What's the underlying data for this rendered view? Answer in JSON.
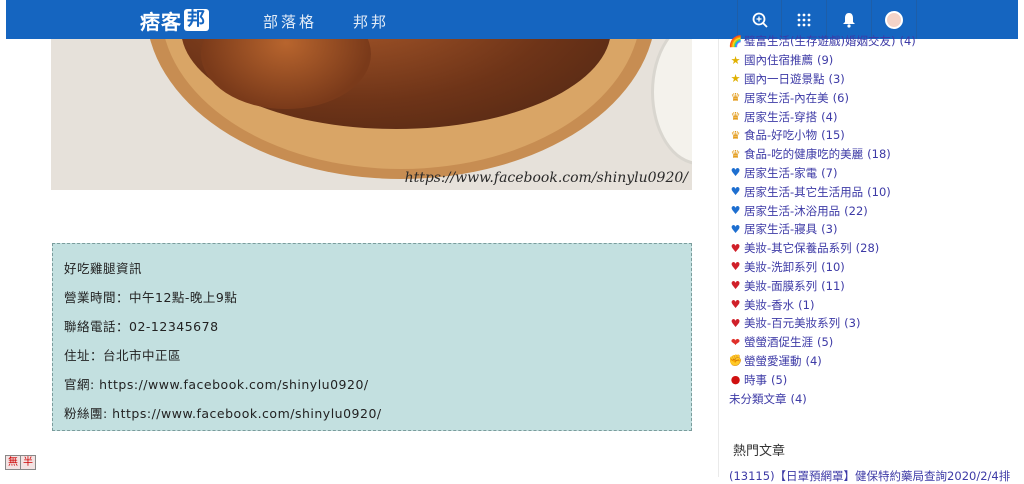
{
  "header": {
    "logo_text": "痞客",
    "logo_box": "邦",
    "nav_blog": "部落格",
    "nav_bang": "邦邦",
    "icons": [
      "search-icon",
      "apps-grid-icon",
      "bell-icon",
      "avatar"
    ]
  },
  "photo": {
    "watermark": "https://www.facebook.com/shinylu0920/"
  },
  "info": {
    "title": "好吃雞腿資訊",
    "hours": "營業時間：中午12點-晚上9點",
    "phone": "聯絡電話：02-12345678",
    "address": "住址：台北市中正區",
    "website": "官網: https://www.facebook.com/shinylu0920/",
    "fanpage": "粉絲團: https://www.facebook.com/shinylu0920/"
  },
  "sidebar": {
    "categories": [
      {
        "icon": "rainbow-icon",
        "label": "璧富生活(生存遊戲)婚姻交友)",
        "count": "(4)"
      },
      {
        "icon": "star-icon",
        "label": "國內住宿推薦",
        "count": "(9)"
      },
      {
        "icon": "star-icon",
        "label": "國內一日遊景點",
        "count": "(3)"
      },
      {
        "icon": "crown-icon",
        "label": "居家生活-內在美",
        "count": "(6)"
      },
      {
        "icon": "crown-icon",
        "label": "居家生活-穿搭",
        "count": "(4)"
      },
      {
        "icon": "crown-icon",
        "label": "食品-好吃小物",
        "count": "(15)"
      },
      {
        "icon": "crown-icon",
        "label": "食品-吃的健康吃的美麗",
        "count": "(18)"
      },
      {
        "icon": "blue-heart-icon",
        "label": "居家生活-家電",
        "count": "(7)"
      },
      {
        "icon": "blue-heart-icon",
        "label": "居家生活-其它生活用品",
        "count": "(10)"
      },
      {
        "icon": "blue-heart-icon",
        "label": "居家生活-沐浴用品",
        "count": "(22)"
      },
      {
        "icon": "blue-heart-icon",
        "label": "居家生活-寢具",
        "count": "(3)"
      },
      {
        "icon": "red-heart-icon",
        "label": "美妝-其它保養品系列",
        "count": "(28)"
      },
      {
        "icon": "red-heart-icon",
        "label": "美妝-洗卸系列",
        "count": "(10)"
      },
      {
        "icon": "red-heart-icon",
        "label": "美妝-面膜系列",
        "count": "(11)"
      },
      {
        "icon": "red-heart-icon",
        "label": "美妝-香水",
        "count": "(1)"
      },
      {
        "icon": "red-heart-icon",
        "label": "美妝-百元美妝系列",
        "count": "(3)"
      },
      {
        "icon": "heart-ribbon-icon",
        "label": "螢螢酒促生涯",
        "count": "(5)"
      },
      {
        "icon": "muscle-icon",
        "label": "螢螢愛運動",
        "count": "(4)"
      },
      {
        "icon": "red-circle-icon",
        "label": "時事",
        "count": "(5)"
      },
      {
        "icon": "",
        "label": "未分類文章",
        "count": "(4)"
      }
    ],
    "hot_title": "熱門文章",
    "hot_first": "(13115)【日罩預網罩】健保特約藥局查詢2020/2/4排"
  },
  "bottom_buttons": [
    "無",
    "半"
  ],
  "colors": {
    "nav_bg": "#1565c0",
    "info_bg": "#c3e0e0",
    "link": "#3d3aa6"
  }
}
